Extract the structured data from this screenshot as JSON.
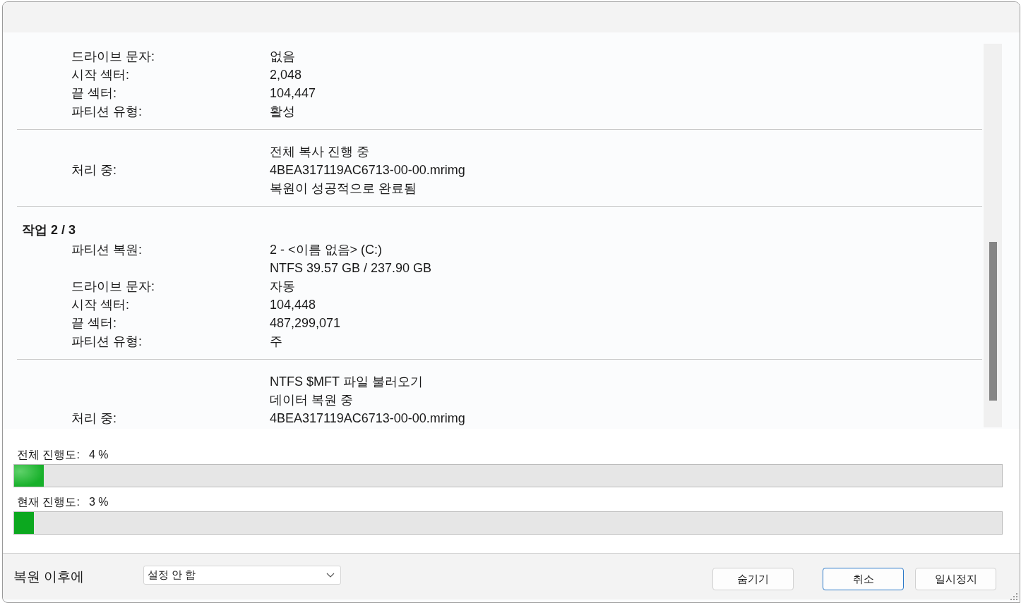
{
  "log": {
    "sections": [
      {
        "lines": [
          {
            "label": "드라이브 문자:",
            "value": "없음"
          },
          {
            "label": "시작 섹터:",
            "value": "2,048"
          },
          {
            "label": "끝 섹터:",
            "value": "104,447"
          },
          {
            "label": "파티션 유형:",
            "value": "활성"
          }
        ]
      },
      {
        "lines": [
          {
            "value": "전체 복사 진행 중"
          },
          {
            "label": "처리 중:",
            "value": "4BEA317119AC6713-00-00.mrimg"
          },
          {
            "value": "복원이 성공적으로 완료됨"
          }
        ]
      },
      {
        "heading": "작업 2 / 3",
        "lines": [
          {
            "label": "파티션 복원:",
            "value": "2 - <이름 없음> (C:)"
          },
          {
            "value": "NTFS 39.57 GB / 237.90 GB"
          },
          {
            "label": "드라이브 문자:",
            "value": "자동"
          },
          {
            "label": "시작 섹터:",
            "value": "104,448"
          },
          {
            "label": "끝 섹터:",
            "value": "487,299,071"
          },
          {
            "label": "파티션 유형:",
            "value": "주"
          }
        ]
      },
      {
        "lines": [
          {
            "value": "NTFS $MFT 파일 불러오기"
          },
          {
            "value": "데이터 복원 중"
          },
          {
            "label": "처리 중:",
            "value": "4BEA317119AC6713-00-00.mrimg"
          }
        ]
      }
    ]
  },
  "progress": [
    {
      "label": "전체 진행도:",
      "reading": "4 %",
      "level": 0.03,
      "kind": "gradient"
    },
    {
      "label": "현재 진행도:",
      "reading": "3 %",
      "level": 0.02,
      "kind": "solid"
    }
  ],
  "footer": {
    "label": "복원 이후에",
    "dropdown": {
      "value": "설정 안 함"
    },
    "buttons": [
      {
        "label": "숨기기",
        "default": false
      },
      {
        "label": "취소",
        "default": true
      },
      {
        "label": "일시정지",
        "default": false
      }
    ]
  }
}
